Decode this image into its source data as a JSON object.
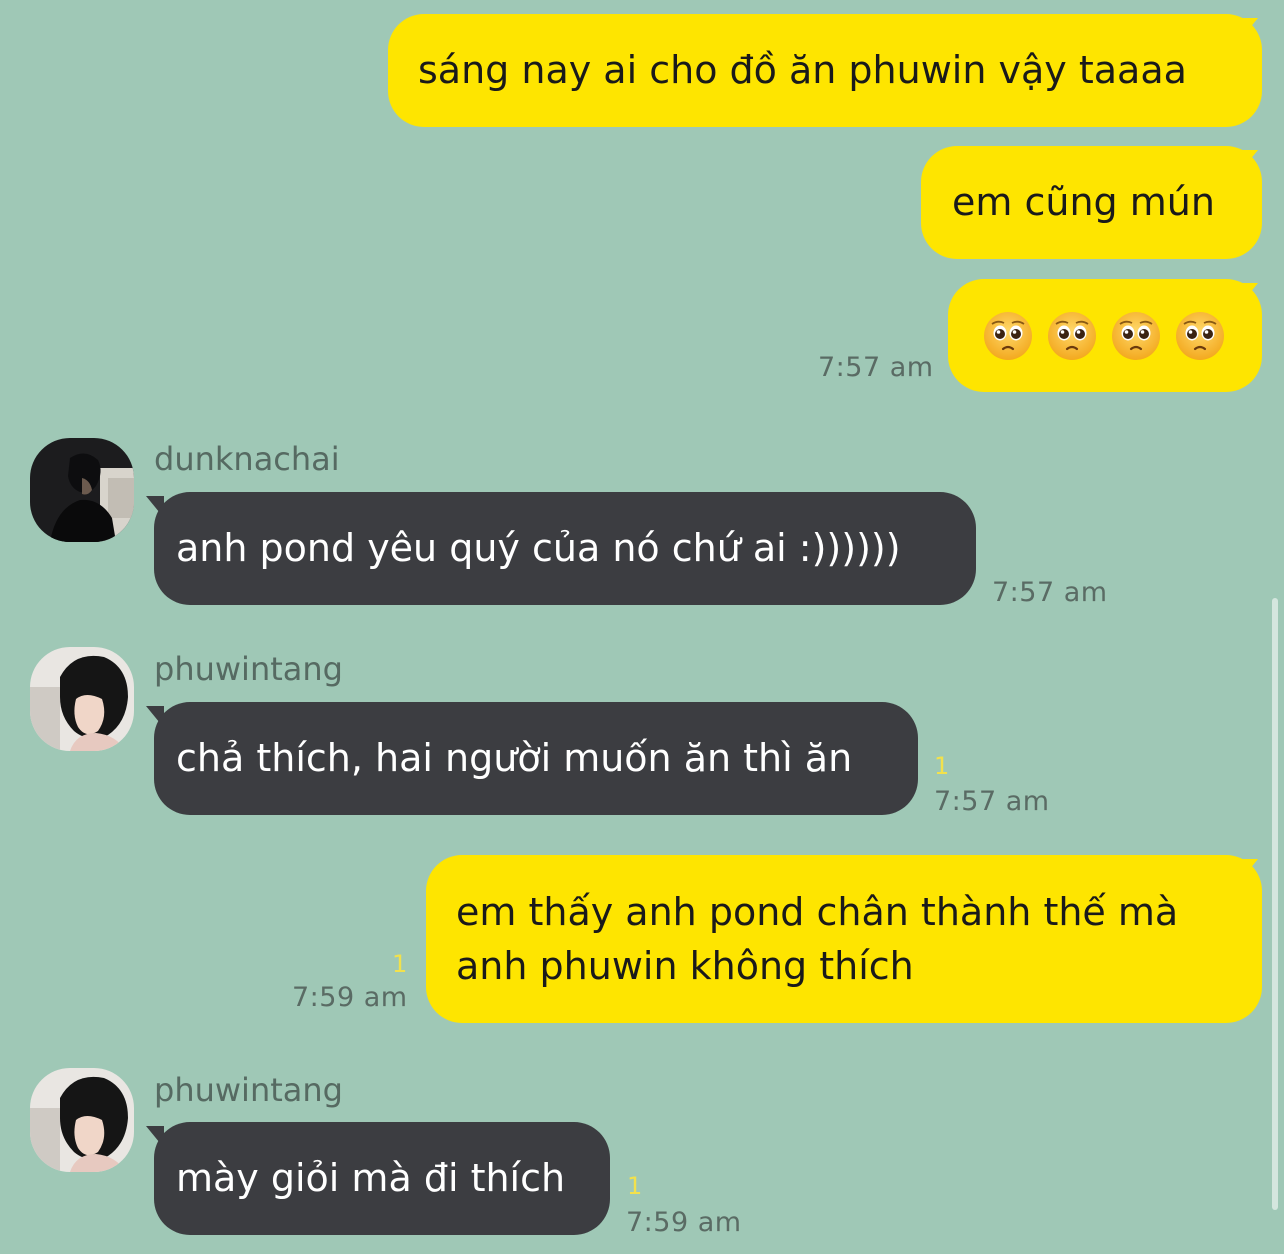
{
  "messages": [
    {
      "id": "m1",
      "direction": "outgoing",
      "text": "sáng nay ai cho đồ ăn phuwin vậy taaaa"
    },
    {
      "id": "m2",
      "direction": "outgoing",
      "text": "em cũng mún"
    },
    {
      "id": "m3",
      "direction": "outgoing",
      "emoji_count": 4,
      "emoji_name": "pleading-face",
      "time": "7:57 am"
    },
    {
      "id": "m4",
      "direction": "incoming",
      "sender": "dunknachai",
      "text": "anh pond yêu quý của nó chứ ai :))))))",
      "time": "7:57 am"
    },
    {
      "id": "m5",
      "direction": "incoming",
      "sender": "phuwintang",
      "text": "chả thích, hai người muốn ăn thì ăn",
      "unread": "1",
      "time": "7:57 am"
    },
    {
      "id": "m6",
      "direction": "outgoing",
      "text_line1": "em thấy anh pond chân thành thế mà",
      "text_line2": "anh phuwin không thích",
      "unread": "1",
      "time": "7:59 am"
    },
    {
      "id": "m7",
      "direction": "incoming",
      "sender": "phuwintang",
      "text": "mày giỏi mà đi thích",
      "unread": "1",
      "time": "7:59 am"
    }
  ],
  "colors": {
    "background": "#9fc8b6",
    "outgoing_bubble": "#fee500",
    "incoming_bubble": "#3c3d41",
    "unread_count": "#f2e14c"
  }
}
